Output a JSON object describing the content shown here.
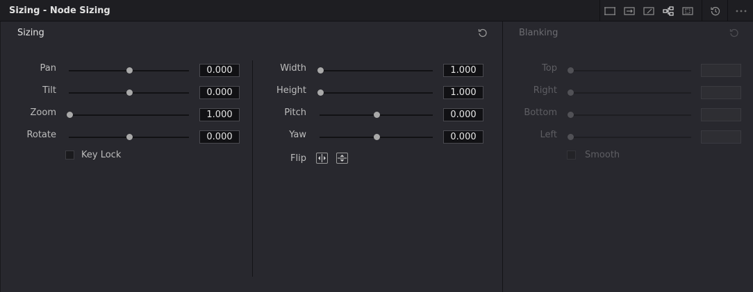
{
  "window": {
    "title": "Sizing - Node Sizing"
  },
  "toolbar": {
    "icons": [
      "output-sizing-icon",
      "input-sizing-icon",
      "edit-sizing-icon",
      "node-sizing-icon",
      "reference-sizing-icon",
      "reset-all-icon",
      "more-options-icon"
    ]
  },
  "sizing": {
    "title": "Sizing",
    "left_column": [
      {
        "label": "Pan",
        "value": "0.000",
        "position": 0.5
      },
      {
        "label": "Tilt",
        "value": "0.000",
        "position": 0.5
      },
      {
        "label": "Zoom",
        "value": "1.000",
        "position": 0.0
      },
      {
        "label": "Rotate",
        "value": "0.000",
        "position": 0.5
      }
    ],
    "key_lock": {
      "label": "Key Lock",
      "checked": false
    },
    "right_column": [
      {
        "label": "Width",
        "value": "1.000",
        "position": 0.0
      },
      {
        "label": "Height",
        "value": "1.000",
        "position": 0.0
      },
      {
        "label": "Pitch",
        "value": "0.000",
        "position": 0.5
      },
      {
        "label": "Yaw",
        "value": "0.000",
        "position": 0.5
      }
    ],
    "flip": {
      "label": "Flip"
    }
  },
  "blanking": {
    "title": "Blanking",
    "rows": [
      {
        "label": "Top",
        "value": "",
        "position": 0.0
      },
      {
        "label": "Right",
        "value": "",
        "position": 0.0
      },
      {
        "label": "Bottom",
        "value": "",
        "position": 0.0
      },
      {
        "label": "Left",
        "value": "",
        "position": 0.0
      }
    ],
    "smooth": {
      "label": "Smooth",
      "checked": false
    }
  },
  "colors": {
    "background": "#28282e",
    "header": "#1e1e22",
    "value_box": "#111114"
  }
}
